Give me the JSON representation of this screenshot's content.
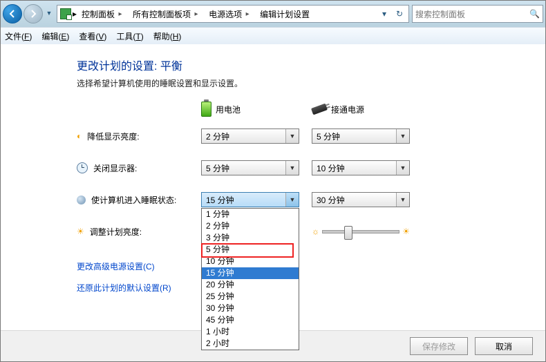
{
  "breadcrumb": {
    "items": [
      "控制面板",
      "所有控制面板项",
      "电源选项",
      "编辑计划设置"
    ]
  },
  "search": {
    "placeholder": "搜索控制面板"
  },
  "menu": {
    "file": "文件(F)",
    "edit": "编辑(E)",
    "view": "查看(V)",
    "tools": "工具(T)",
    "help": "帮助(H)"
  },
  "page": {
    "title": "更改计划的设置: 平衡",
    "subtitle": "选择希望计算机使用的睡眠设置和显示设置。",
    "col_battery": "用电池",
    "col_ac": "接通电源"
  },
  "rows": {
    "dim": {
      "label": "降低显示亮度:",
      "battery": "2 分钟",
      "ac": "5 分钟"
    },
    "off": {
      "label": "关闭显示器:",
      "battery": "5 分钟",
      "ac": "10 分钟"
    },
    "sleep": {
      "label": "使计算机进入睡眠状态:",
      "battery": "15 分钟",
      "ac": "30 分钟"
    },
    "bright": {
      "label": "调整计划亮度:"
    }
  },
  "dropdown": {
    "options": [
      "1 分钟",
      "2 分钟",
      "3 分钟",
      "5 分钟",
      "10 分钟",
      "15 分钟",
      "20 分钟",
      "25 分钟",
      "30 分钟",
      "45 分钟",
      "1 小时",
      "2 小时"
    ],
    "selected": "15 分钟",
    "highlighted": "5 分钟"
  },
  "links": {
    "advanced": "更改高级电源设置(C)",
    "restore": "还原此计划的默认设置(R)"
  },
  "footer": {
    "save": "保存修改",
    "cancel": "取消"
  }
}
